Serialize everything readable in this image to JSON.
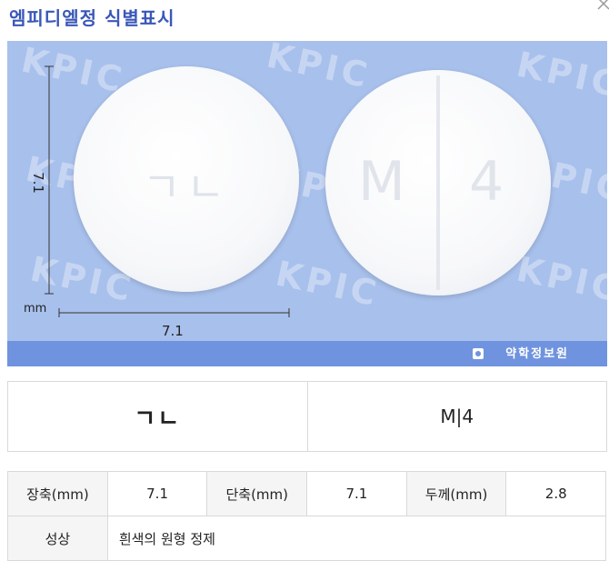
{
  "header": {
    "title": "엠피디엘정 식별표시"
  },
  "image": {
    "watermark": "KPIC",
    "brand": "약학정보원",
    "ruler_unit": "mm",
    "height_label": "7.1",
    "width_label": "7.1",
    "pill_front_text": "ㄱㄴ",
    "pill_back_text_left": "M",
    "pill_back_text_right": "4"
  },
  "markings": {
    "front": "ㄱㄴ",
    "back": "M|4"
  },
  "specs": {
    "length_label": "장축(mm)",
    "length_value": "7.1",
    "width_label": "단축(mm)",
    "width_value": "7.1",
    "thickness_label": "두께(mm)",
    "thickness_value": "2.8",
    "property_label": "성상",
    "property_value": "흰색의 원형 정제"
  },
  "colors": {
    "title": "#3a57b8",
    "photo_bg": "#a8c0ec",
    "photo_footer": "#6f93de"
  }
}
